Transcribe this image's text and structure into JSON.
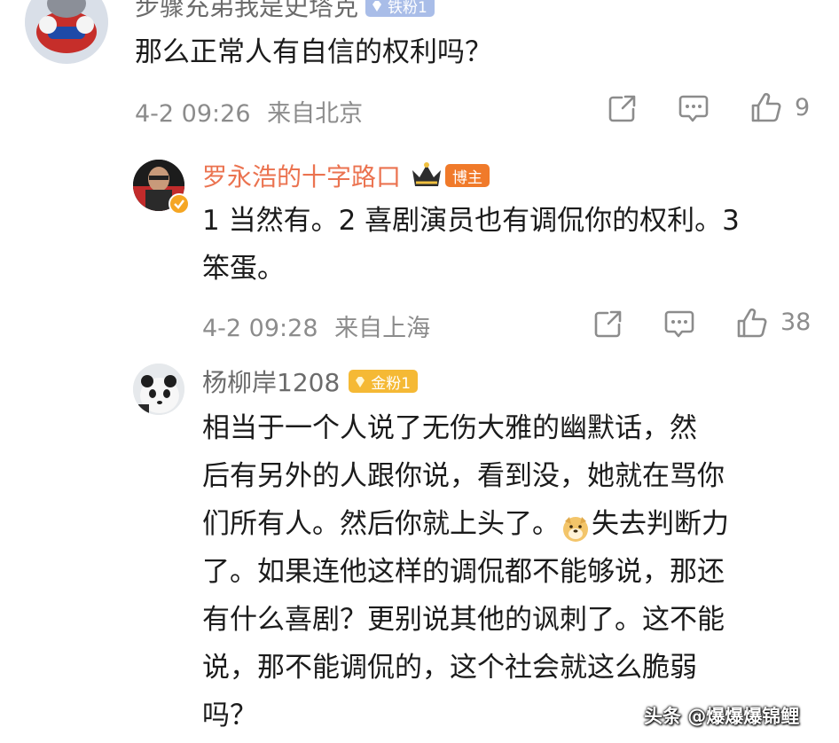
{
  "comment1": {
    "username": "步骤充弟我是史塔克",
    "badge": "铁粉1",
    "text": "那么正常人有自信的权利吗？",
    "time": "4-2 09:26",
    "location": "来自北京",
    "likes": "9"
  },
  "reply1": {
    "username": "罗永浩的十字路口",
    "badge": "博主",
    "text_line1": "1 当然有。2 喜剧演员也有调侃你的权利。3",
    "text_line2": "笨蛋。",
    "time": "4-2 09:28",
    "location": "来自上海",
    "likes": "38"
  },
  "reply2": {
    "username": "杨柳岸1208",
    "badge": "金粉1",
    "lines": [
      "相当于一个人说了无伤大雅的幽默话，然",
      "后有另外的人跟你说，看到没，她就在骂你",
      "们所有人。然后你就上头了。",
      "失去判断力",
      "了。如果连他这样的调侃都不能够说，那还",
      "有什么喜剧？更别说其他的讽刺了。这不能",
      "说，那不能调侃的，这个社会就这么脆弱",
      "吗？"
    ]
  },
  "watermark": "头条 @爆爆爆锦鲤",
  "colors": {
    "link_orange": "#eb7350",
    "meta_gray": "#8c8c8c",
    "iron_badge": "#a9bde8",
    "blogger_badge": "#f07a2a",
    "gold_badge": "#f5b935"
  },
  "icons": [
    "share-icon",
    "comment-icon",
    "like-icon",
    "crown-icon",
    "doge-emoji"
  ]
}
